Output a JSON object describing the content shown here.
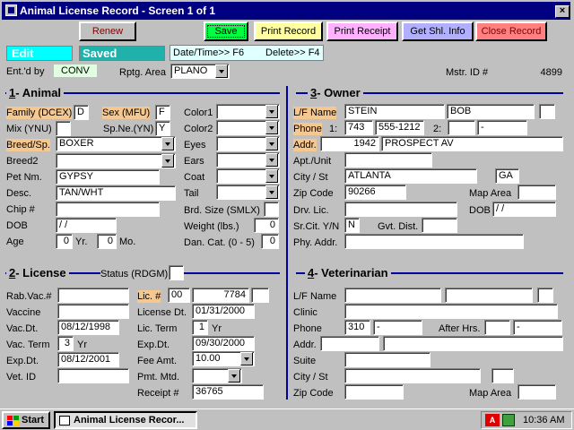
{
  "window": {
    "title": "Animal License Record - Screen 1 of 1",
    "close": "×"
  },
  "toolbar": {
    "renew": "Renew",
    "save": "Save",
    "print_record": "Print Record",
    "print_receipt": "Print Receipt",
    "get_shl_info": "Get Shl. Info",
    "close_record": "Close Record"
  },
  "status": {
    "mode": "Edit",
    "state": "Saved",
    "hint_date": "Date/Time>> F6",
    "hint_delete": "Delete>> F4"
  },
  "top": {
    "entd_by_label": "Ent.'d by",
    "entd_by": "CONV",
    "rptg_area_label": "Rptg. Area",
    "rptg_area": "PLANO",
    "mstr_id_label": "Mstr. ID #",
    "mstr_id": "4899"
  },
  "animal": {
    "section_num": "1",
    "section": "- Animal",
    "family_label": "Family (DCEX)",
    "family": "D",
    "sex_label": "Sex (MFU)",
    "sex": "F",
    "mix_label": "Mix (YNU)",
    "mix": "",
    "spne_label": "Sp.Ne.(YN)",
    "spne": "Y",
    "breed_label": "Breed/Sp.",
    "breed": "BOXER",
    "breed2_label": "Breed2",
    "breed2": "",
    "petnm_label": "Pet Nm.",
    "petnm": "GYPSY",
    "desc_label": "Desc.",
    "desc": "TAN/WHT",
    "chip_label": "Chip #",
    "chip": "",
    "dob_label": "DOB",
    "dob": " / /",
    "age_label": "Age",
    "age_yr": "0",
    "yr_label": "Yr.",
    "age_mo": "0",
    "mo_label": "Mo.",
    "color1_label": "Color1",
    "color1": "",
    "color2_label": "Color2",
    "color2": "",
    "eyes_label": "Eyes",
    "eyes": "",
    "ears_label": "Ears",
    "ears": "",
    "coat_label": "Coat",
    "coat": "",
    "tail_label": "Tail",
    "tail": "",
    "brdsize_label": "Brd. Size (SMLX)",
    "brdsize": "",
    "weight_label": "Weight (lbs.)",
    "weight": "0",
    "dancat_label": "Dan. Cat. (0 - 5)",
    "dancat": "0"
  },
  "owner": {
    "section_num": "3",
    "section": "- Owner",
    "lfname_label": "L/F Name",
    "last": "STEIN",
    "first": "BOB",
    "mi": "",
    "phone_label": "Phone",
    "phone1_label": "1:",
    "area": "743",
    "phone": "555-1212",
    "phone2_label": "2:",
    "area2": "",
    "phone2": " -",
    "addr_label": "Addr.",
    "addr_num": "1942",
    "addr_street": "PROSPECT AV",
    "apt_label": "Apt./Unit",
    "apt": "",
    "city_label": "City / St",
    "city": "ATLANTA",
    "state": "GA",
    "zip_label": "Zip Code",
    "zip": "90266",
    "maparea_label": "Map Area",
    "maparea": "",
    "drvlic_label": "Drv. Lic.",
    "drvlic": "",
    "dob_label": "DOB",
    "dob": " / /",
    "srcit_label": "Sr.Cit. Y/N",
    "srcit": "N",
    "gvtdist_label": "Gvt. Dist.",
    "gvtdist": "",
    "phyaddr_label": "Phy. Addr.",
    "phyaddr": ""
  },
  "license": {
    "section_num": "2",
    "section": "- License",
    "status_label": "Status (RDGM)",
    "status": "",
    "rabvac_label": "Rab.Vac.#",
    "rabvac": "",
    "vaccine_label": "Vaccine",
    "vaccine": "",
    "vacdt_label": "Vac.Dt.",
    "vacdt": "08/12/1998",
    "vacterm_label": "Vac. Term",
    "vacterm": "3",
    "vacterm_unit": "Yr",
    "expdt_label": "Exp.Dt.",
    "expdt": "08/12/2001",
    "vetid_label": "Vet. ID",
    "vetid": "",
    "lic_label": "Lic. #",
    "lic_prefix": "00",
    "lic_num": "7784",
    "lic_suffix": "",
    "licdt_label": "License Dt.",
    "licdt": "01/31/2000",
    "licterm_label": "Lic. Term",
    "licterm": "1",
    "licterm_unit": "Yr",
    "licexp_label": "Exp.Dt.",
    "licexp": "09/30/2000",
    "fee_label": "Fee Amt.",
    "fee": "10.00",
    "pmt_label": "Pmt. Mtd.",
    "pmt": "",
    "receipt_label": "Receipt #",
    "receipt": "36765"
  },
  "vet": {
    "section_num": "4",
    "section": "- Veterinarian",
    "lfname_label": "L/F Name",
    "clinic_label": "Clinic",
    "phone_label": "Phone",
    "area": "310",
    "phone": " -",
    "afterhrs_label": "After Hrs.",
    "afterhrs_phone": " -",
    "addr_label": "Addr.",
    "suite_label": "Suite",
    "city_label": "City / St",
    "zip_label": "Zip Code",
    "maparea_label": "Map Area"
  },
  "taskbar": {
    "start": "Start",
    "task": "Animal License Recor...",
    "time": "10:36 AM"
  },
  "colors": {
    "title": "#000080",
    "section_line": "#0000a0",
    "highlight": "#f4c890",
    "edit_bg": "#00ffff",
    "saved_bg": "#20b2aa",
    "save_btn": "#00ff40",
    "print_btn": "#ffffa0",
    "receipt_btn": "#ffb0ff",
    "shl_btn": "#b0b0ff",
    "close_btn": "#ff8080"
  }
}
